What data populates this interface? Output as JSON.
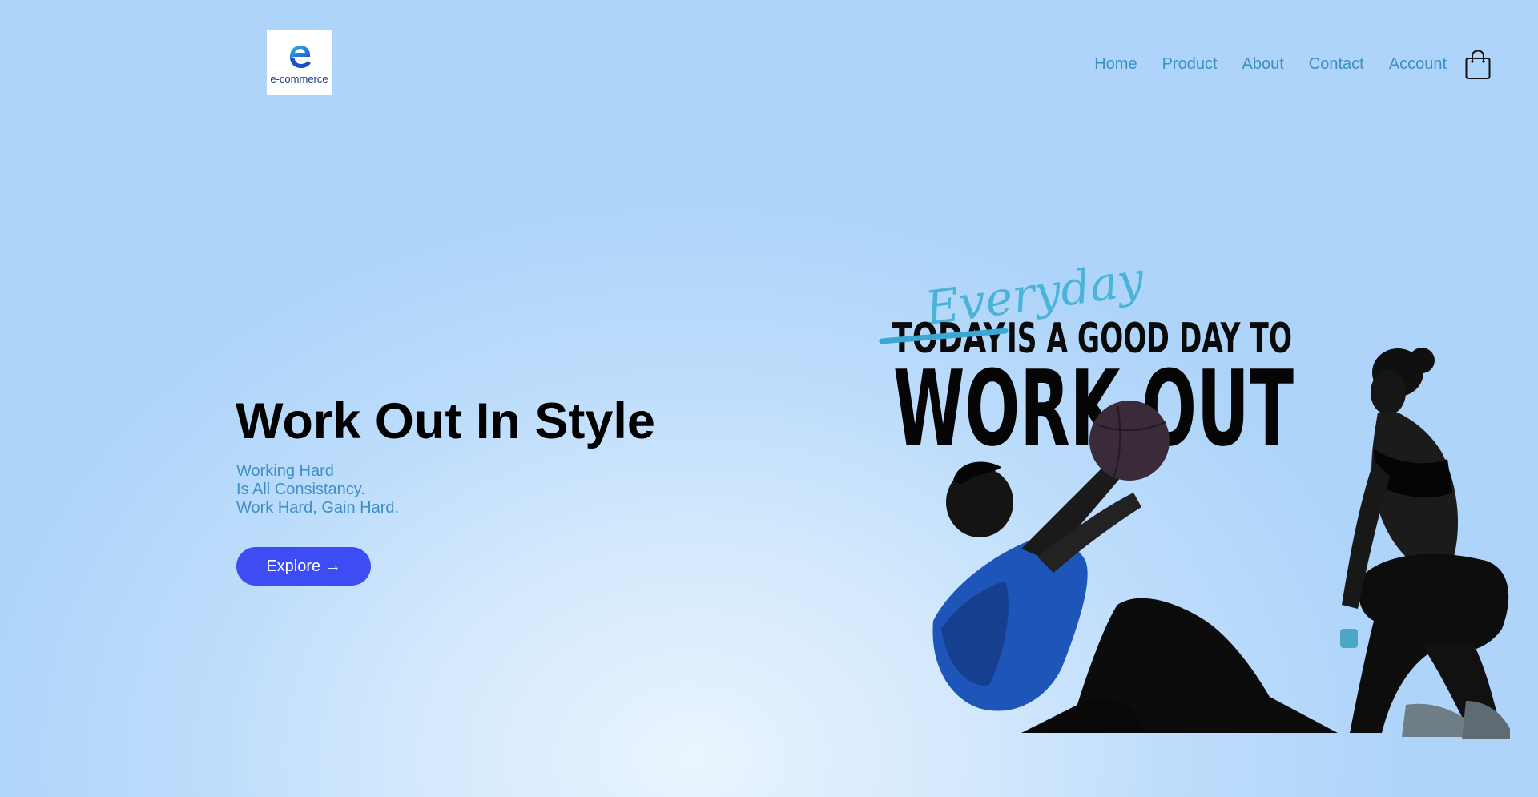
{
  "logo": {
    "text": "e-commerce"
  },
  "nav": {
    "items": [
      {
        "label": "Home"
      },
      {
        "label": "Product"
      },
      {
        "label": "About"
      },
      {
        "label": "Contact"
      },
      {
        "label": "Account"
      }
    ]
  },
  "cart": {
    "icon": "shopping-bag-icon"
  },
  "hero": {
    "title": "Work Out In Style",
    "subtitle_lines": [
      "Working Hard",
      "Is All Consistancy.",
      "Work Hard, Gain Hard."
    ],
    "cta_label": "Explore →"
  },
  "hero_image": {
    "script_text": "Everyday",
    "struck_text": "TODAY",
    "line1": "IS A GOOD DAY TO",
    "line2": "WORK-OUT"
  },
  "colors": {
    "nav_link": "#3d8fc4",
    "subtitle": "#3d8fc4",
    "button": "#3e4cf4",
    "accent_script": "#4ab3d8"
  }
}
